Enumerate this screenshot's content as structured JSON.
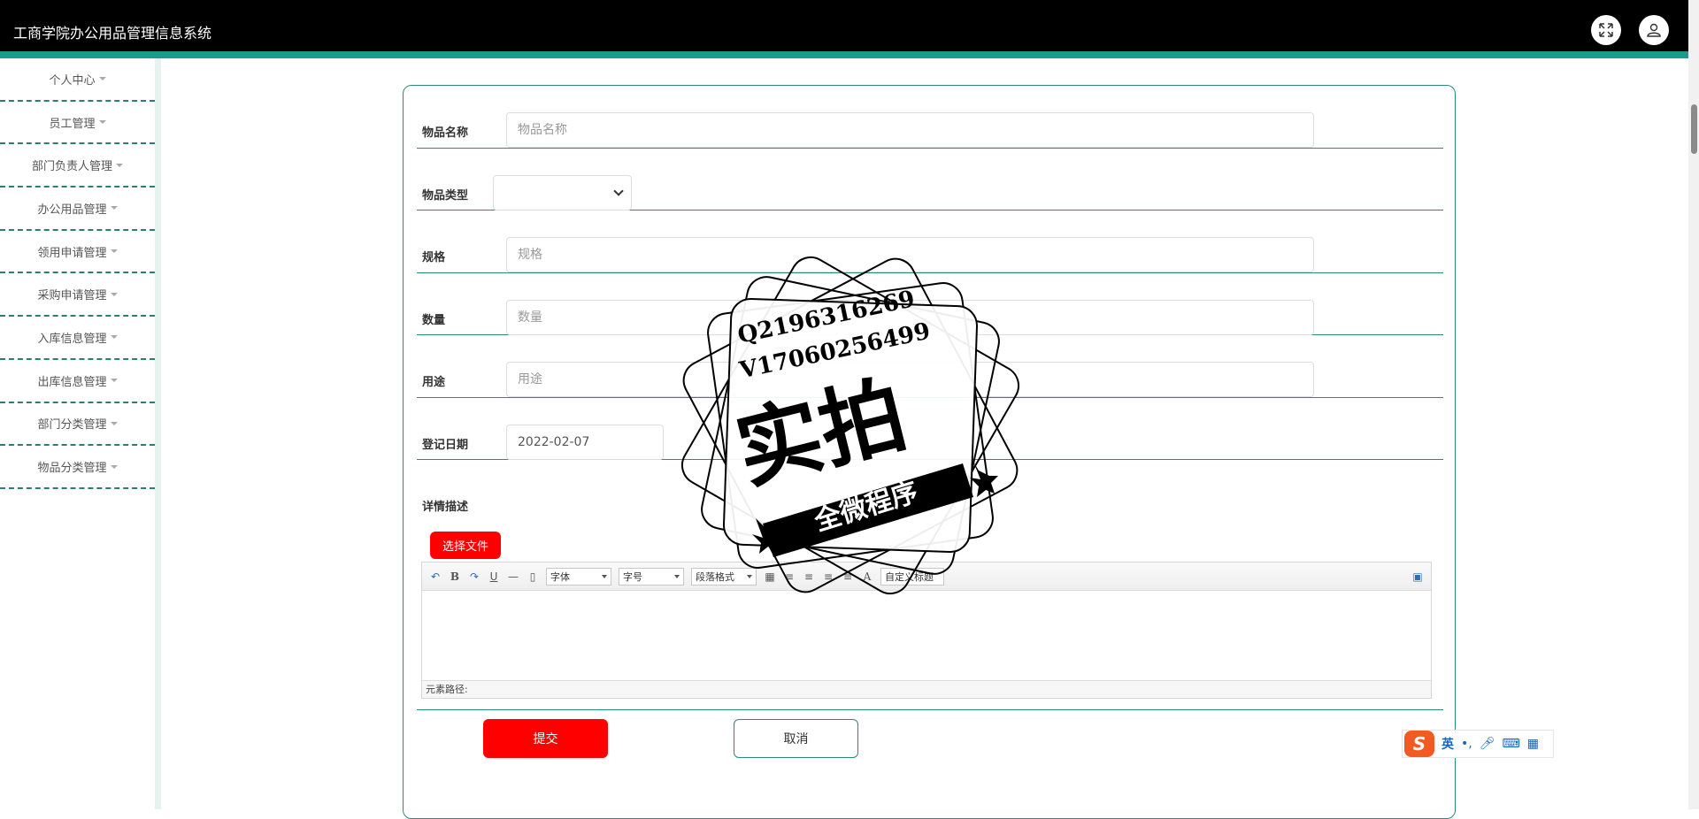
{
  "app": {
    "title": "工商学院办公用品管理信息系统"
  },
  "header": {
    "fullscreen_icon": "expand-icon",
    "user_icon": "user-icon"
  },
  "sidebar": {
    "items": [
      {
        "label": "个人中心"
      },
      {
        "label": "员工管理"
      },
      {
        "label": "部门负责人管理"
      },
      {
        "label": "办公用品管理"
      },
      {
        "label": "领用申请管理"
      },
      {
        "label": "采购申请管理"
      },
      {
        "label": "入库信息管理"
      },
      {
        "label": "出库信息管理"
      },
      {
        "label": "部门分类管理"
      },
      {
        "label": "物品分类管理"
      }
    ]
  },
  "form": {
    "name": {
      "label": "物品名称",
      "placeholder": "物品名称",
      "value": ""
    },
    "type": {
      "label": "物品类型",
      "value": ""
    },
    "spec": {
      "label": "规格",
      "placeholder": "规格",
      "value": ""
    },
    "quantity": {
      "label": "数量",
      "placeholder": "数量",
      "value": ""
    },
    "purpose": {
      "label": "用途",
      "placeholder": "用途",
      "value": ""
    },
    "date": {
      "label": "登记日期",
      "value": "2022-02-07"
    },
    "detail": {
      "label": "详情描述"
    },
    "file_button": "选择文件",
    "editor": {
      "font_select": "字体",
      "size_select": "字号",
      "format_select": "段落格式",
      "custom_title": "自定义标题",
      "bold": "B",
      "underline": "U",
      "font_color": "A",
      "path_label": "元素路径:"
    },
    "submit_label": "提交",
    "cancel_label": "取消"
  },
  "ime": {
    "logo": "S",
    "mode": "英",
    "punct": "•,",
    "icons": [
      "mic-icon",
      "keyboard-icon",
      "grid-icon"
    ]
  },
  "watermark": {
    "line1": "Q2196316269",
    "line2": "V17060256499",
    "main": "实拍",
    "banner": "全微程序"
  }
}
